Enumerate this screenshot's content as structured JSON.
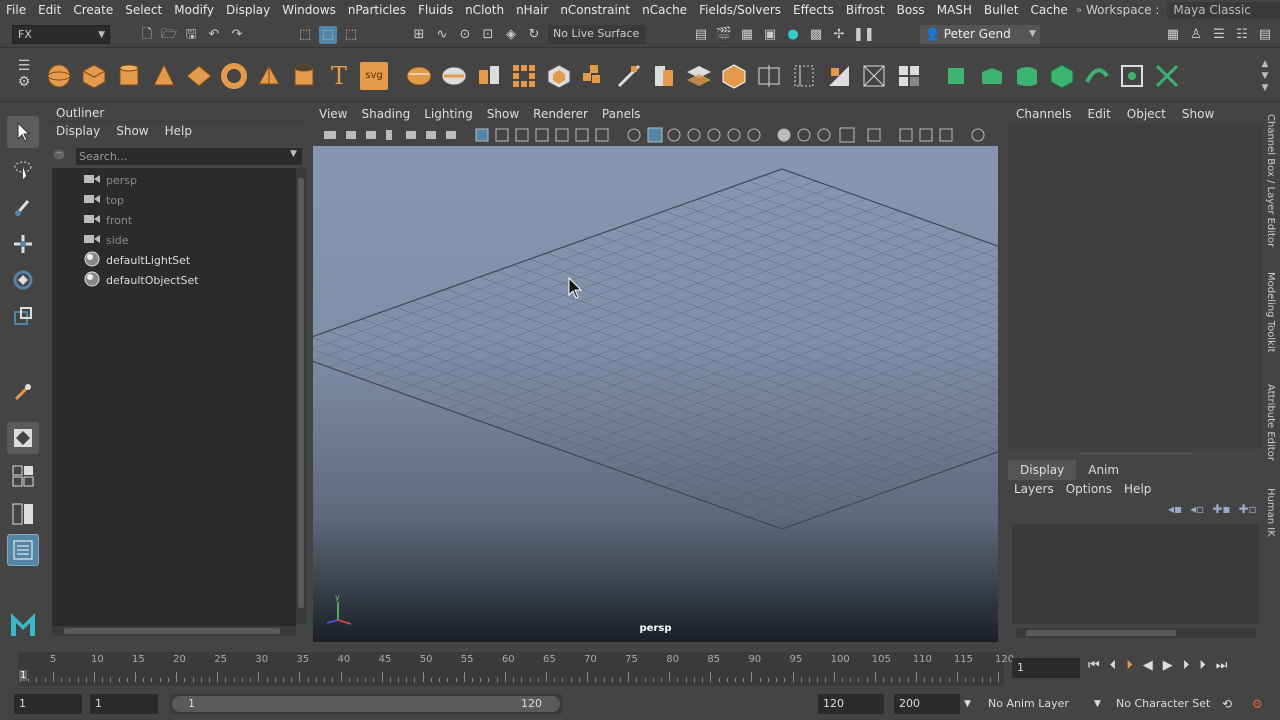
{
  "menubar": {
    "items": [
      "File",
      "Edit",
      "Create",
      "Select",
      "Modify",
      "Display",
      "Windows",
      "nParticles",
      "Fluids",
      "nCloth",
      "nHair",
      "nConstraint",
      "nCache",
      "Fields/Solvers",
      "Effects",
      "Bifrost",
      "Boss",
      "MASH",
      "Bullet",
      "Cache"
    ],
    "workspace_label": "Workspace :",
    "workspace_value": "Maya Classic"
  },
  "statusline": {
    "menuset": "FX",
    "live_surface": "No Live Surface",
    "user": "Peter Gend"
  },
  "outliner": {
    "title": "Outliner",
    "menu": [
      "Display",
      "Show",
      "Help"
    ],
    "search_placeholder": "Search...",
    "items": [
      {
        "label": "persp",
        "kind": "camera"
      },
      {
        "label": "top",
        "kind": "camera"
      },
      {
        "label": "front",
        "kind": "camera"
      },
      {
        "label": "side",
        "kind": "camera"
      },
      {
        "label": "defaultLightSet",
        "kind": "set"
      },
      {
        "label": "defaultObjectSet",
        "kind": "set"
      }
    ]
  },
  "viewport": {
    "menu": [
      "View",
      "Shading",
      "Lighting",
      "Show",
      "Renderer",
      "Panels"
    ],
    "camera_label": "persp"
  },
  "channelbox": {
    "menu": [
      "Channels",
      "Edit",
      "Object",
      "Show"
    ]
  },
  "layereditor": {
    "tabs": [
      "Display",
      "Anim"
    ],
    "menu": [
      "Layers",
      "Options",
      "Help"
    ]
  },
  "side_tabs": [
    "Channel Box / Layer Editor",
    "Modeling Toolkit",
    "Attribute Editor",
    "Human IK"
  ],
  "timeslider": {
    "ticks": [
      "5",
      "10",
      "15",
      "20",
      "25",
      "30",
      "35",
      "40",
      "45",
      "50",
      "55",
      "60",
      "65",
      "70",
      "75",
      "80",
      "85",
      "90",
      "95",
      "100",
      "105",
      "110",
      "115",
      "120"
    ],
    "current_marker": "1",
    "current_frame": "1"
  },
  "rangebar": {
    "start": "1",
    "playback_start": "1",
    "range_start": "1",
    "range_end": "120",
    "playback_end": "120",
    "end": "200",
    "anim_layer": "No Anim Layer",
    "character_set": "No Character Set"
  },
  "colors": {
    "accent": "#5285a6",
    "shelf_orange": "#e39a4b",
    "shelf_green": "#3cb371"
  }
}
